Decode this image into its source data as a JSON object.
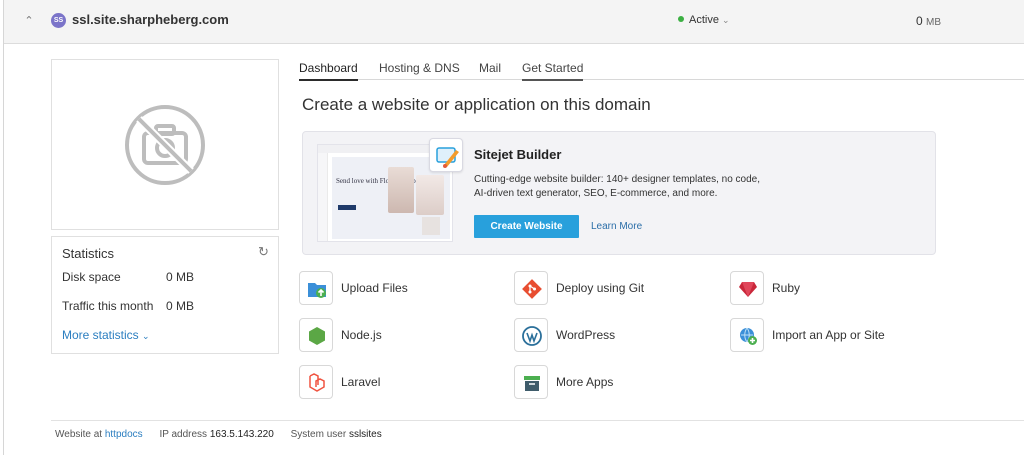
{
  "header": {
    "site_icon_text": "SS",
    "domain": "ssl.site.sharpheberg.com",
    "status": "Active",
    "size_value": "0",
    "size_unit": "MB"
  },
  "tabs": [
    "Dashboard",
    "Hosting & DNS",
    "Mail",
    "Get Started"
  ],
  "heading": "Create a website or application on this domain",
  "sitejet": {
    "title": "Sitejet Builder",
    "desc_line1": "Cutting-edge website builder: 140+ designer templates, no code,",
    "desc_line2": "AI-driven text generator, SEO, E-commerce, and more.",
    "create_label": "Create Website",
    "learn_label": "Learn More",
    "preview_text": "Send love with Flower Shop"
  },
  "statistics": {
    "title": "Statistics",
    "disk_label": "Disk space",
    "disk_value": "0 MB",
    "traffic_label": "Traffic this month",
    "traffic_value": "0 MB",
    "more_label": "More statistics"
  },
  "apps": [
    {
      "label": "Upload Files",
      "icon": "folder-upload-icon"
    },
    {
      "label": "Deploy using Git",
      "icon": "git-icon"
    },
    {
      "label": "Ruby",
      "icon": "ruby-icon"
    },
    {
      "label": "Node.js",
      "icon": "nodejs-icon"
    },
    {
      "label": "WordPress",
      "icon": "wordpress-icon"
    },
    {
      "label": "Import an App or Site",
      "icon": "import-globe-icon"
    },
    {
      "label": "Laravel",
      "icon": "laravel-icon"
    },
    {
      "label": "More Apps",
      "icon": "more-apps-icon"
    }
  ],
  "footer": {
    "website_at": "Website at",
    "docroot": "httpdocs",
    "ip_label": "IP address",
    "ip": "163.5.143.220",
    "sysuser_label": "System user",
    "sysuser": "sslsites"
  },
  "colors": {
    "accent": "#28a0dc",
    "link": "#2b7ec0",
    "active_status": "#3cb043",
    "site_icon": "#7b74c9"
  }
}
